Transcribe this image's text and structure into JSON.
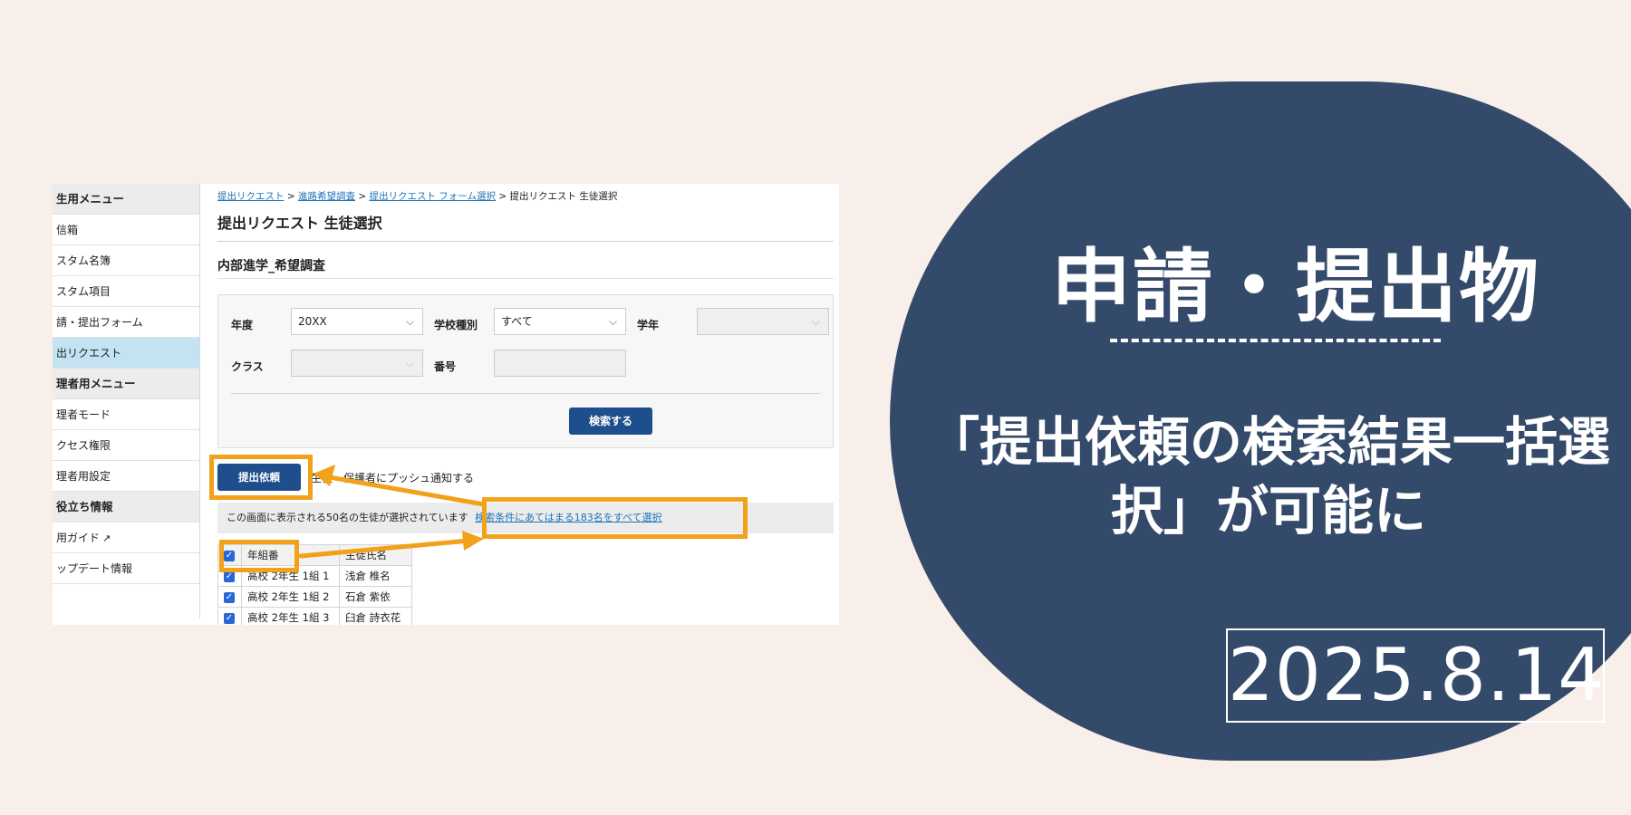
{
  "sidebar": {
    "items": [
      {
        "label": "生用メニュー",
        "type": "head"
      },
      {
        "label": "信箱",
        "type": "item"
      },
      {
        "label": "スタム名簿",
        "type": "item"
      },
      {
        "label": "スタム項目",
        "type": "item"
      },
      {
        "label": "請・提出フォーム",
        "type": "item"
      },
      {
        "label": "出リクエスト",
        "type": "active"
      },
      {
        "label": "理者用メニュー",
        "type": "head"
      },
      {
        "label": "理者モード",
        "type": "item"
      },
      {
        "label": "クセス権限",
        "type": "item"
      },
      {
        "label": "理者用設定",
        "type": "item"
      },
      {
        "label": "役立ち情報",
        "type": "head"
      },
      {
        "label": "用ガイド",
        "type": "item"
      },
      {
        "label": "ップデート情報",
        "type": "item"
      }
    ],
    "external_icon": "external-link-icon"
  },
  "breadcrumb": {
    "links": [
      "提出リクエスト",
      "進路希望調査",
      "提出リクエスト フォーム選択"
    ],
    "separator": " > ",
    "current": "提出リクエスト 生徒選択"
  },
  "page": {
    "title": "提出リクエスト 生徒選択",
    "survey_title": "内部進学_希望調査"
  },
  "filters": {
    "year_label": "年度",
    "year_value": "20XX",
    "school_type_label": "学校種別",
    "school_type_value": "すべて",
    "grade_label": "学年",
    "grade_value": "",
    "class_label": "クラス",
    "class_value": "",
    "number_label": "番号",
    "number_value": "",
    "chevron": "⌵",
    "search_button": "検索する"
  },
  "actions": {
    "submit_request_button": "提出依頼",
    "push_notify_text": "生徒・保護者にプッシュ通知する"
  },
  "selection": {
    "selected_text": "この画面に表示される50名の生徒が選択されています",
    "select_all_link": "検索条件にあてはまる183名をすべて選択"
  },
  "table": {
    "headers": [
      "年組番",
      "生徒氏名"
    ],
    "rows": [
      {
        "class": "高校 2年生 1組 1",
        "name": "浅倉 椎名"
      },
      {
        "class": "高校 2年生 1組 2",
        "name": "石倉 紫依"
      },
      {
        "class": "高校 2年生 1組 3",
        "name": "臼倉 詩衣花"
      }
    ],
    "check_mark": "✓"
  },
  "promo": {
    "heading": "申請・提出物",
    "subtitle_line1": "「提出依頼の検索結果一括選",
    "subtitle_line2": "択」が可能に",
    "date": "2025.8.14"
  },
  "colors": {
    "background": "#f8efea",
    "promo_bg": "#344a6a",
    "highlight": "#f1a11a",
    "primary_button": "#1e4e8c",
    "link": "#1f73b7",
    "active_sidebar": "#c3e3f3"
  }
}
